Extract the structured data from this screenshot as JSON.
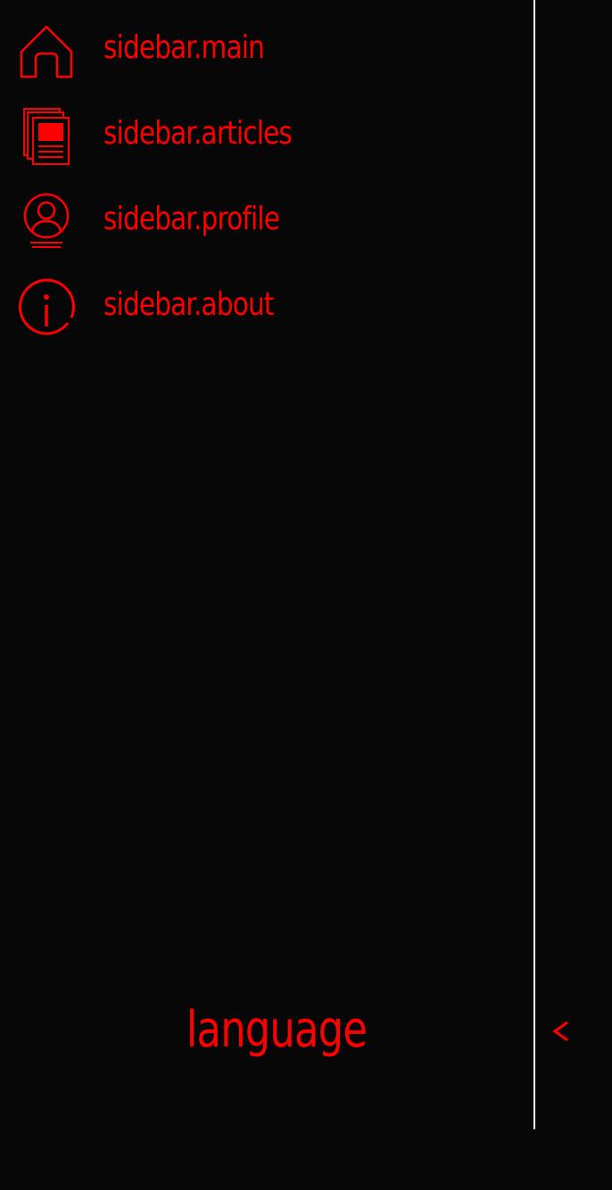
{
  "colors": {
    "background": "#070707",
    "accent": "#ff0000",
    "divider": "#ffffff"
  },
  "sidebar": {
    "items": [
      {
        "label": "sidebar.main",
        "icon": "home-icon"
      },
      {
        "label": "sidebar.articles",
        "icon": "articles-icon"
      },
      {
        "label": "sidebar.profile",
        "icon": "profile-icon"
      },
      {
        "label": "sidebar.about",
        "icon": "info-icon"
      }
    ],
    "language_label": "language",
    "collapse_icon": "chevron-left-icon",
    "collapse_symbol": "<"
  }
}
